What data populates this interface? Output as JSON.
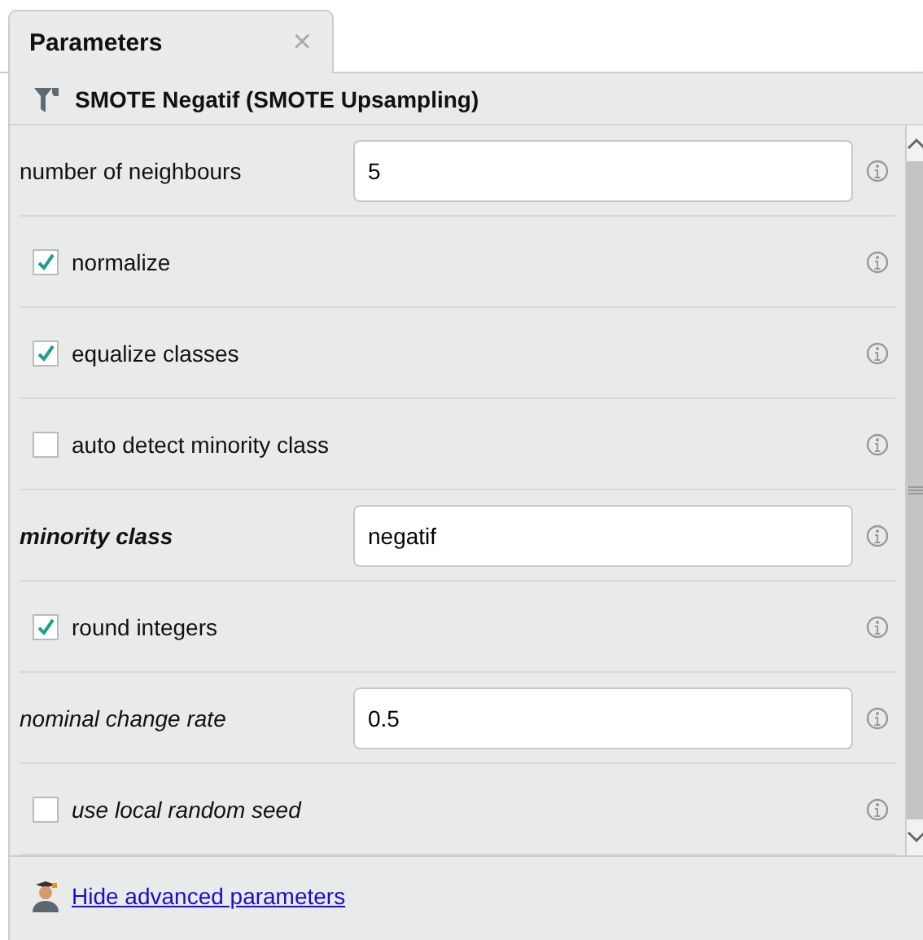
{
  "tabs": [
    {
      "label": "Parameters",
      "close": "×",
      "selected": true
    }
  ],
  "operator": {
    "title": "SMOTE Negatif (SMOTE Upsampling)"
  },
  "parameters": [
    {
      "kind": "text",
      "label": "number of neighbours",
      "value": "5",
      "bold": false,
      "italic": false
    },
    {
      "kind": "checkbox",
      "label": "normalize",
      "checked": true,
      "bold": false,
      "italic": false
    },
    {
      "kind": "checkbox",
      "label": "equalize classes",
      "checked": true,
      "bold": false,
      "italic": false
    },
    {
      "kind": "checkbox",
      "label": "auto detect minority class",
      "checked": false,
      "bold": false,
      "italic": false
    },
    {
      "kind": "text",
      "label": "minority class",
      "value": "negatif",
      "bold": true,
      "italic": true
    },
    {
      "kind": "checkbox",
      "label": "round integers",
      "checked": true,
      "bold": false,
      "italic": false
    },
    {
      "kind": "text",
      "label": "nominal change rate",
      "value": "0.5",
      "bold": false,
      "italic": true
    },
    {
      "kind": "checkbox",
      "label": "use local random seed",
      "checked": false,
      "bold": false,
      "italic": true
    }
  ],
  "footer": {
    "link": "Hide advanced parameters"
  }
}
